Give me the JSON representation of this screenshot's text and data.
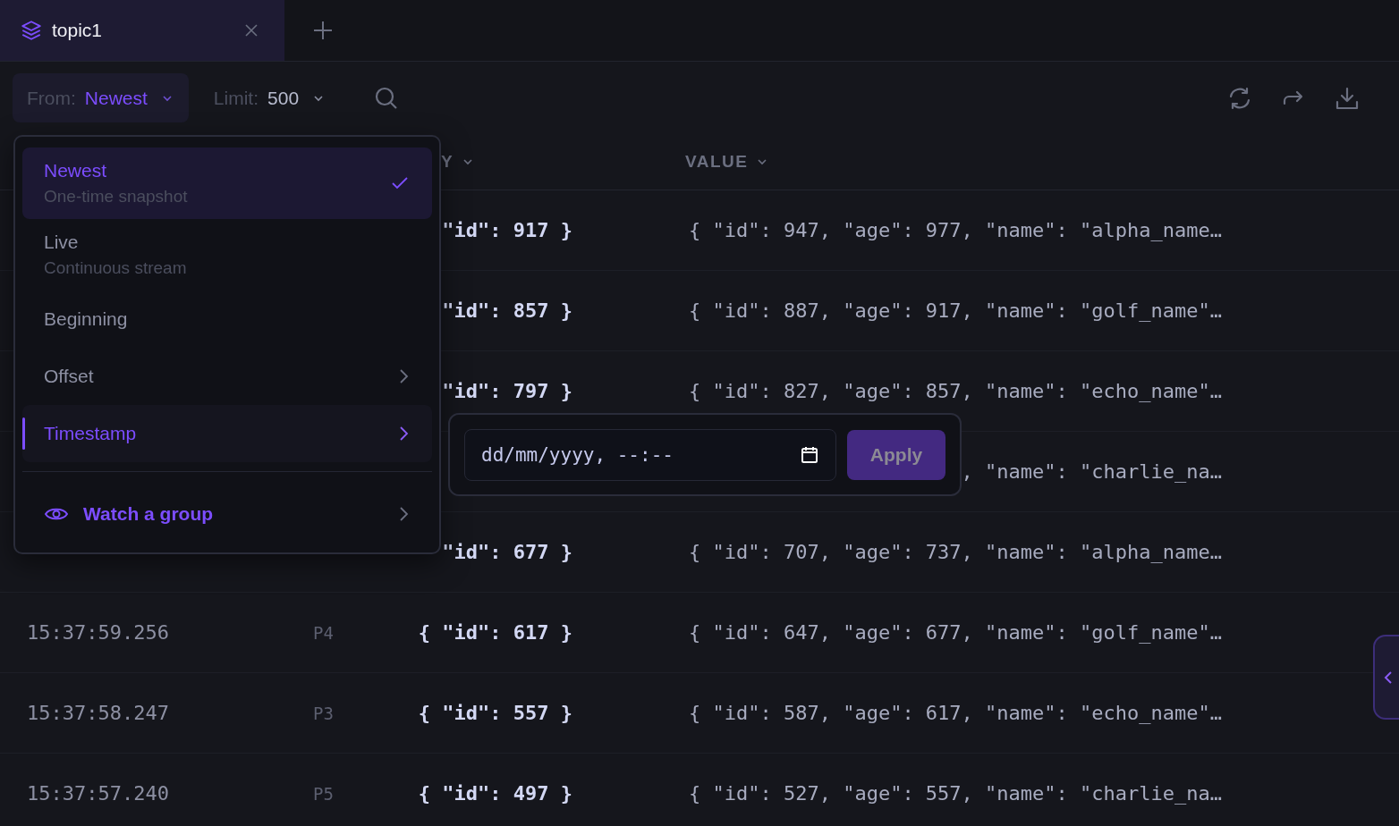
{
  "tabs": [
    {
      "label": "topic1",
      "selected": true
    }
  ],
  "toolbar": {
    "from_label": "From:",
    "from_value": "Newest",
    "limit_label": "Limit:",
    "limit_value": "500"
  },
  "table": {
    "columns": [
      {
        "label": "Y"
      },
      {
        "label": "VALUE"
      }
    ],
    "rows": [
      {
        "key": "\"id\": 917 }",
        "value": "{ \"id\": 947, \"age\": 977, \"name\": \"alpha_name…"
      },
      {
        "key": "\"id\": 857 }",
        "value": "{ \"id\": 887, \"age\": 917, \"name\": \"golf_name\"…"
      },
      {
        "key": "\"id\": 797 }",
        "value": "{ \"id\": 827, \"age\": 857, \"name\": \"echo_name\"…"
      },
      {
        "value": ", \"name\": \"charlie_na…"
      },
      {
        "key": "\"id\": 677 }",
        "value": "{ \"id\": 707, \"age\": 737, \"name\": \"alpha_name…"
      },
      {
        "time": "15:37:59.256",
        "partition": "P4",
        "key": "{ \"id\": 617 }",
        "value": "{ \"id\": 647, \"age\": 677, \"name\": \"golf_name\"…"
      },
      {
        "time": "15:37:58.247",
        "partition": "P3",
        "key": "{ \"id\": 557 }",
        "value": "{ \"id\": 587, \"age\": 617, \"name\": \"echo_name\"…"
      },
      {
        "time": "15:37:57.240",
        "partition": "P5",
        "key": "{ \"id\": 497 }",
        "value": "{ \"id\": 527, \"age\": 557, \"name\": \"charlie_na…"
      }
    ]
  },
  "from_menu": {
    "items": [
      {
        "kind": "option",
        "label": "Newest",
        "description": "One-time snapshot",
        "selected": true,
        "open": false
      },
      {
        "kind": "option",
        "label": "Live",
        "description": "Continuous stream",
        "selected": false,
        "open": false
      },
      {
        "kind": "option",
        "label": "Beginning",
        "selected": false,
        "open": false
      },
      {
        "kind": "submenu",
        "label": "Offset",
        "selected": false,
        "open": false
      },
      {
        "kind": "submenu",
        "label": "Timestamp",
        "selected": false,
        "open": true
      },
      {
        "kind": "action",
        "label": "Watch a group",
        "selected": false,
        "open": false
      }
    ]
  },
  "timestamp_picker": {
    "placeholder": "dd/mm/yyyy, --:--",
    "apply": {
      "label": "Apply",
      "disabled": true
    }
  }
}
